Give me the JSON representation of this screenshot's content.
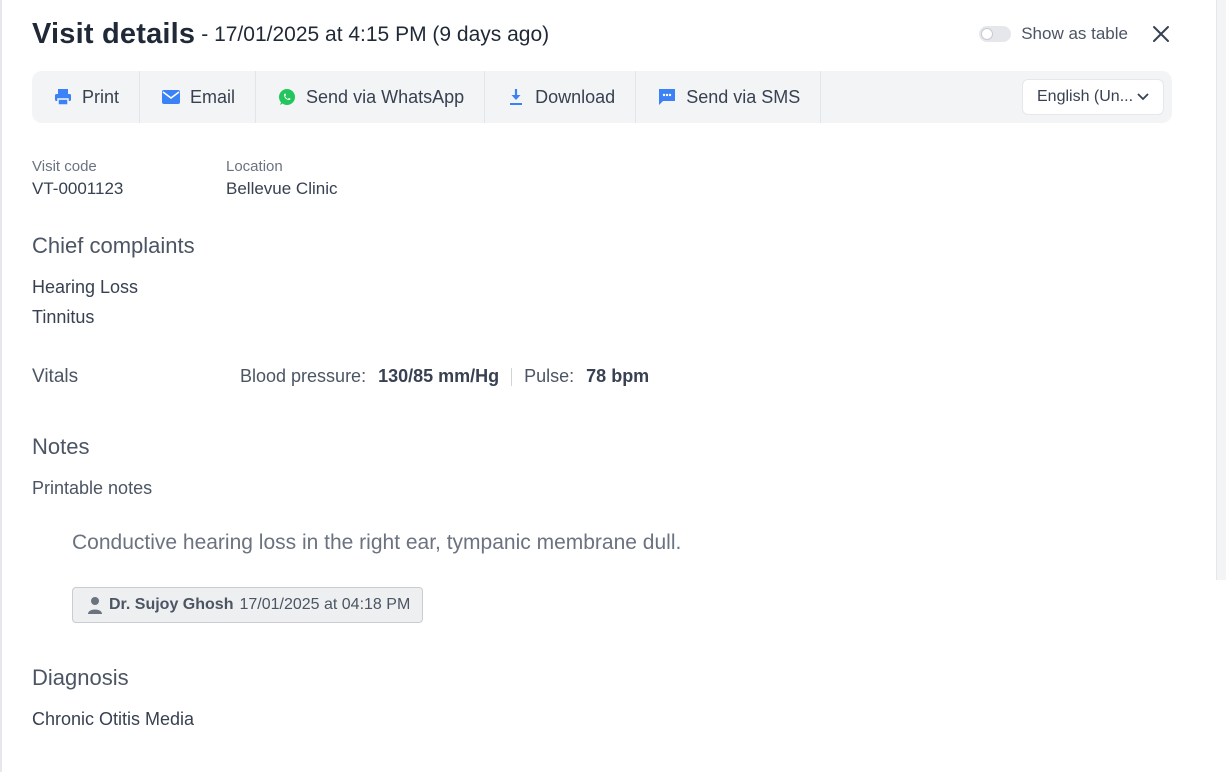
{
  "header": {
    "title": "Visit details",
    "subtitle": "- 17/01/2025 at 4:15 PM (9 days ago)",
    "toggle_label": "Show as table"
  },
  "toolbar": {
    "print_label": "Print",
    "email_label": "Email",
    "whatsapp_label": "Send via WhatsApp",
    "download_label": "Download",
    "sms_label": "Send via SMS",
    "language_value": "English (Un..."
  },
  "visit": {
    "code_label": "Visit code",
    "code_value": "VT-0001123",
    "location_label": "Location",
    "location_value": "Bellevue Clinic"
  },
  "complaints": {
    "title": "Chief complaints",
    "items": [
      "Hearing Loss",
      "Tinnitus"
    ]
  },
  "vitals": {
    "title": "Vitals",
    "bp_label": "Blood pressure:",
    "bp_value": "130/85 mm/Hg",
    "pulse_label": "Pulse:",
    "pulse_value": "78 bpm"
  },
  "notes": {
    "title": "Notes",
    "subtitle": "Printable notes",
    "body": "Conductive hearing loss in the right ear, tympanic membrane dull.",
    "author": "Dr. Sujoy Ghosh",
    "timestamp": "17/01/2025 at 04:18 PM"
  },
  "diagnosis": {
    "title": "Diagnosis",
    "items": [
      "Chronic Otitis Media"
    ]
  },
  "colors": {
    "accent_blue": "#3b82f6",
    "whatsapp_green": "#22c55e",
    "toolbar_bg": "#f3f4f6"
  },
  "icons": {
    "print": "printer-icon",
    "email": "envelope-icon",
    "whatsapp": "whatsapp-icon",
    "download": "download-icon",
    "sms": "chat-icon",
    "close": "close-icon",
    "language_dropdown": "chevron-down-icon",
    "author": "user-icon"
  }
}
